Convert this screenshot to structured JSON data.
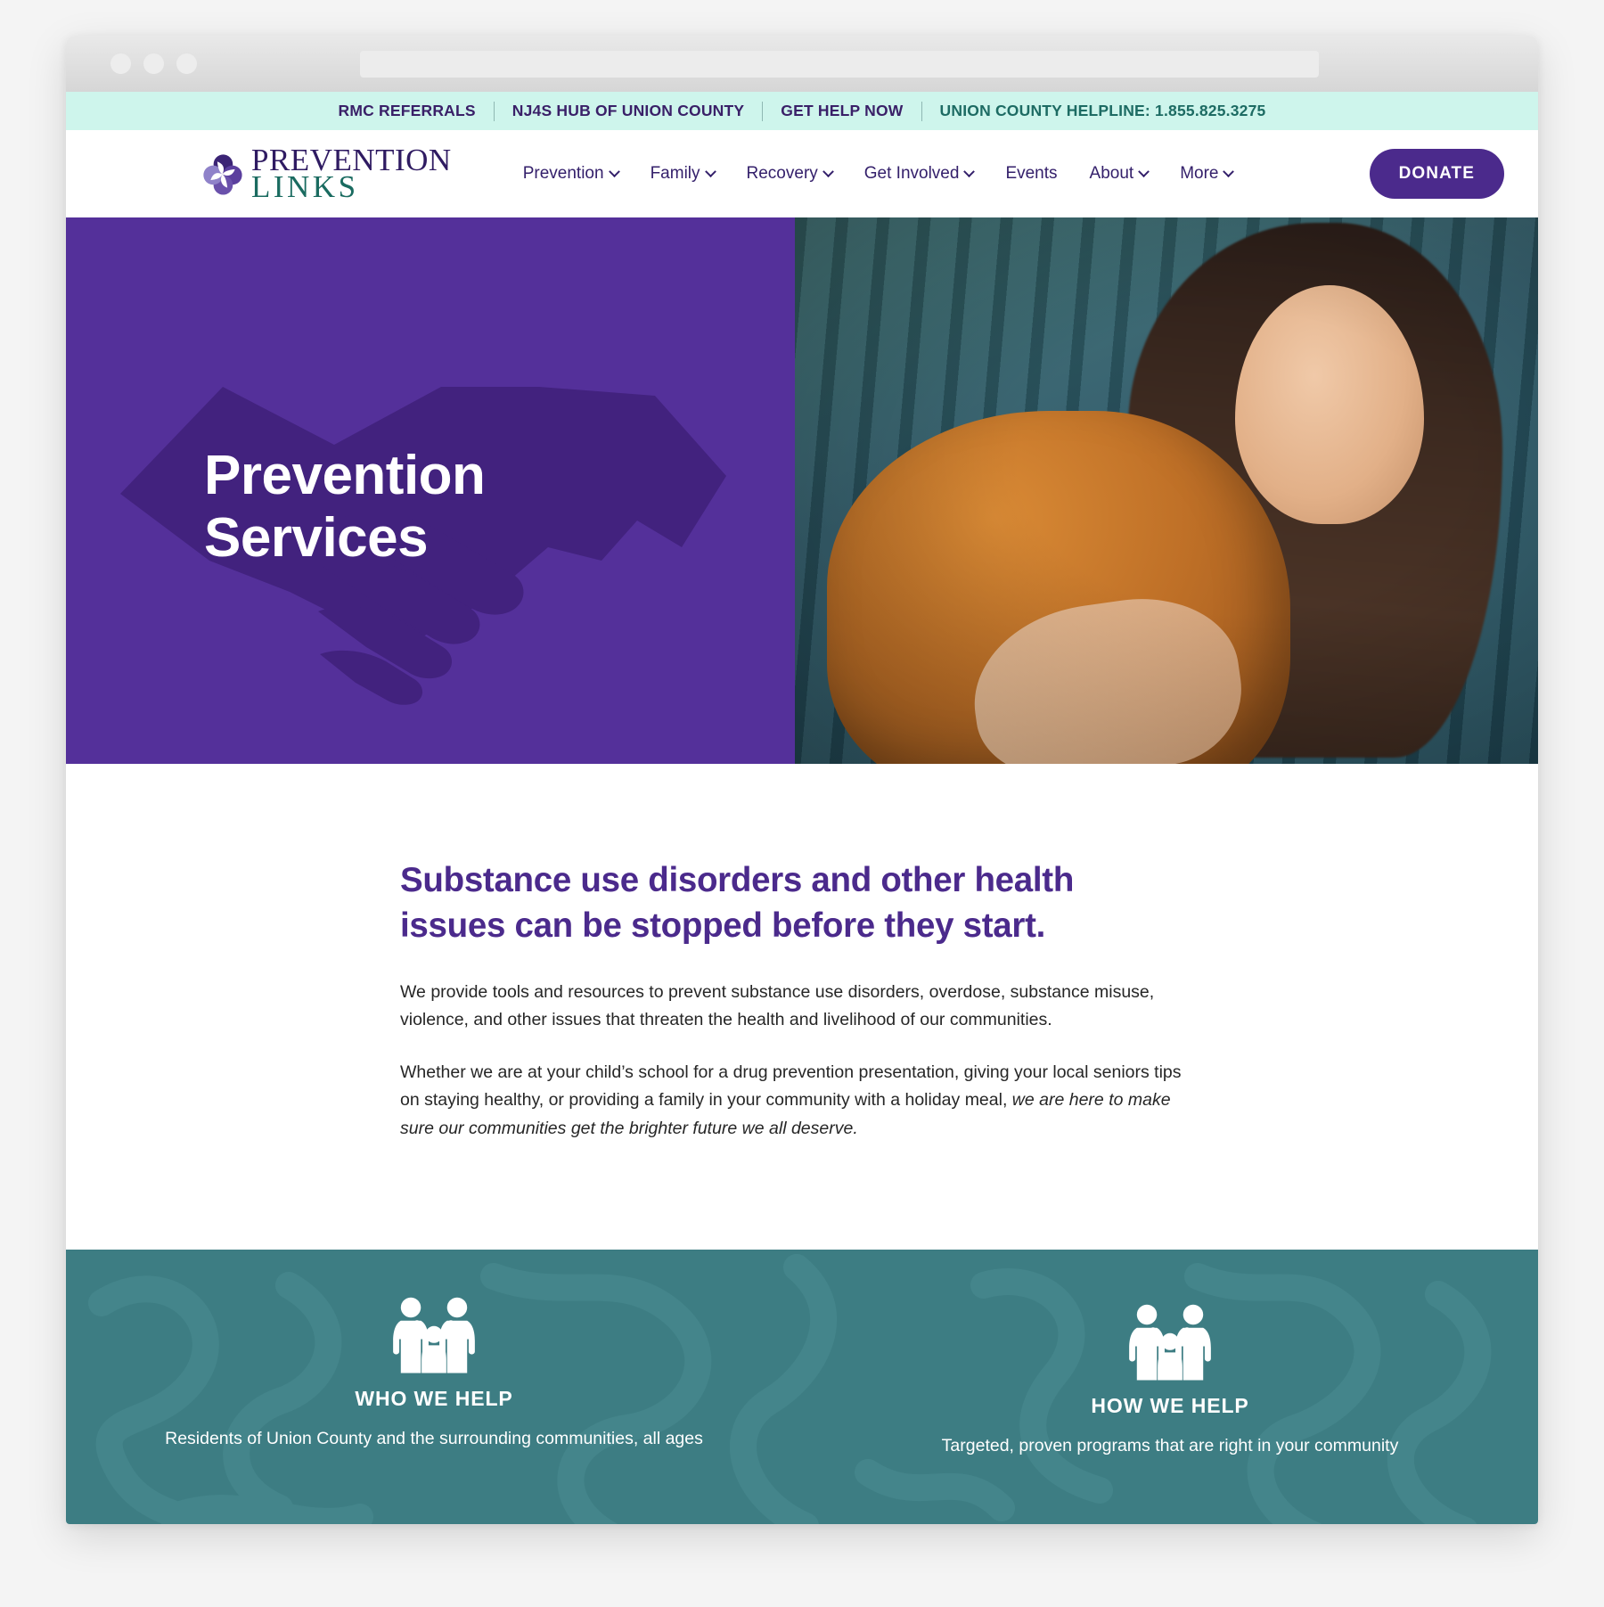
{
  "browser": {
    "traffic_lights": [
      "close",
      "minimize",
      "maximize"
    ],
    "address_value": "",
    "address_placeholder": ""
  },
  "utility_bar": {
    "background": "#cef5ec",
    "links": [
      {
        "label": "RMC REFERRALS",
        "color": "#3a2068"
      },
      {
        "label": "NJ4S HUB OF UNION COUNTY",
        "color": "#3a2068"
      },
      {
        "label": "GET HELP NOW",
        "color": "#3a2068"
      },
      {
        "label": "UNION COUNTY HELPLINE: 1.855.825.3275",
        "color": "#1d6b63"
      }
    ]
  },
  "header": {
    "logo": {
      "line1": "PREVENTION",
      "line2": "LINKS",
      "line1_color": "#2f1b62",
      "line2_color": "#1a6b60",
      "mark": "pinwheel-flower-icon"
    },
    "nav": [
      {
        "label": "Prevention",
        "has_dropdown": true
      },
      {
        "label": "Family",
        "has_dropdown": true
      },
      {
        "label": "Recovery",
        "has_dropdown": true
      },
      {
        "label": "Get Involved",
        "has_dropdown": true
      },
      {
        "label": "Events",
        "has_dropdown": false
      },
      {
        "label": "About",
        "has_dropdown": true
      },
      {
        "label": "More",
        "has_dropdown": true
      }
    ],
    "donate_label": "DONATE",
    "donate_color": "#4b2a8c"
  },
  "hero": {
    "title_line1": "Prevention",
    "title_line2": "Services",
    "background_color": "#54309a",
    "watermark": "handshake-icon",
    "photo_alt": "young woman in orange sherpa jacket smiling"
  },
  "intro": {
    "heading_line1": "Substance use disorders and other health",
    "heading_line2": "issues can be stopped before they start.",
    "heading_color": "#4b2a8c",
    "paragraph1": "We provide tools and resources to prevent substance use disorders, overdose, substance misuse, violence, and other issues that threaten the health and livelihood of our communities.",
    "paragraph2_plain": "Whether we are at your child’s school for a drug prevention presentation, giving your local seniors tips on staying healthy, or providing a family in your community with a holiday meal, ",
    "paragraph2_italic": "we are here to make sure our communities get the brighter future we all deserve."
  },
  "feature_band": {
    "background_color": "#3d7d83",
    "columns": [
      {
        "icon": "family-holding-child-icon",
        "title": "WHO WE HELP",
        "description": "Residents of Union County and the surrounding communities, all ages"
      },
      {
        "icon": "family-holding-child-icon",
        "title": "HOW WE HELP",
        "description": "Targeted, proven programs that are right in your community"
      }
    ]
  }
}
